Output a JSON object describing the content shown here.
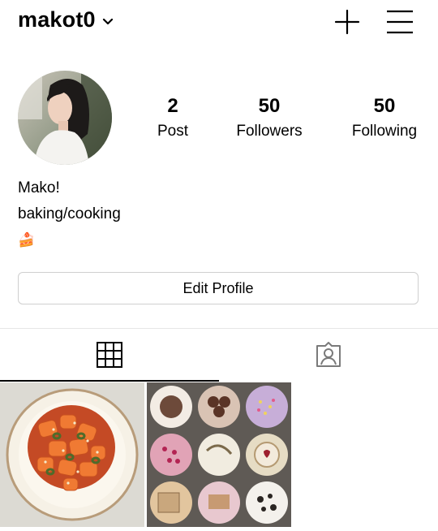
{
  "header": {
    "username": "makot0",
    "icons": [
      "chevron-down-icon",
      "plus-icon",
      "menu-icon"
    ]
  },
  "profile": {
    "stats": [
      {
        "value": "2",
        "label": "Post"
      },
      {
        "value": "50",
        "label": "Followers"
      },
      {
        "value": "50",
        "label": "Following"
      }
    ],
    "bio": {
      "name": "Mako!",
      "line": "baking/cooking",
      "emoji": "🍰"
    },
    "edit_button_label": "Edit Profile"
  },
  "tabs": {
    "items": [
      "grid-icon",
      "tagged-icon"
    ],
    "active": "grid-icon"
  },
  "posts": [
    {
      "subject": "tteokbokki-bowl"
    },
    {
      "subject": "cupcake-box"
    }
  ]
}
